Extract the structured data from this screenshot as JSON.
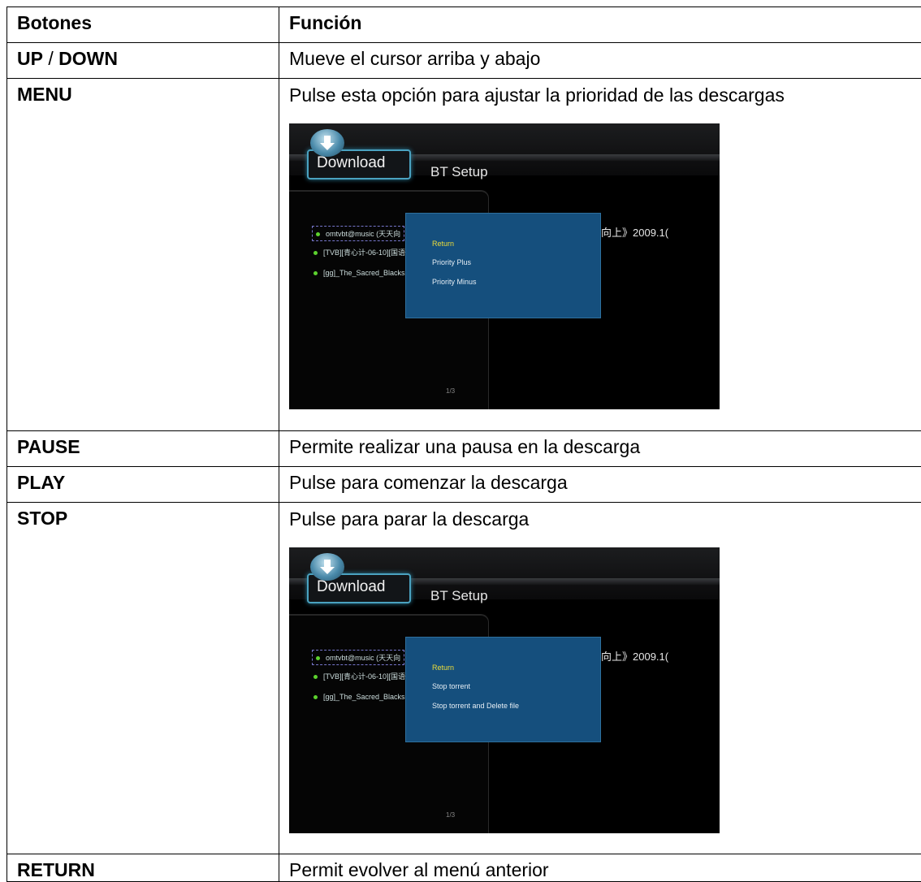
{
  "header": {
    "col1": "Botones",
    "col2": "Función"
  },
  "rows": [
    {
      "key_a": "UP",
      "sep": " / ",
      "key_b": "DOWN",
      "desc": "Mueve el cursor arriba y abajo"
    },
    {
      "key": "MENU",
      "desc": "Pulse esta opción para ajustar la prioridad de las descargas"
    },
    {
      "key": "PAUSE",
      "desc": "Permite realizar una pausa en la descarga"
    },
    {
      "key": "PLAY",
      "desc": "Pulse para comenzar la descarga"
    },
    {
      "key": "STOP",
      "desc": "Pulse para parar la descarga"
    },
    {
      "key": "RETURN",
      "desc": "Permit evolver al menú anterior"
    }
  ],
  "screens": [
    {
      "tab_download": "Download",
      "tab_bt": "BT Setup",
      "items": [
        "omtvbt@music (天天向",
        "[TVB][青心计-06-10][国语",
        "[gg]_The_Sacred_Blacks"
      ],
      "right_text": "向上》2009.1(",
      "options": [
        "Return",
        "Priority Plus",
        "Priority Minus"
      ],
      "pager": "1/3"
    },
    {
      "tab_download": "Download",
      "tab_bt": "BT Setup",
      "items": [
        "omtvbt@music (天天向",
        "[TVB][青心计-06-10][国语",
        "[gg]_The_Sacred_Blacks"
      ],
      "right_text": "向上》2009.1(",
      "options": [
        "Return",
        "Stop torrent",
        "Stop torrent and Delete file"
      ],
      "pager": "1/3"
    }
  ]
}
